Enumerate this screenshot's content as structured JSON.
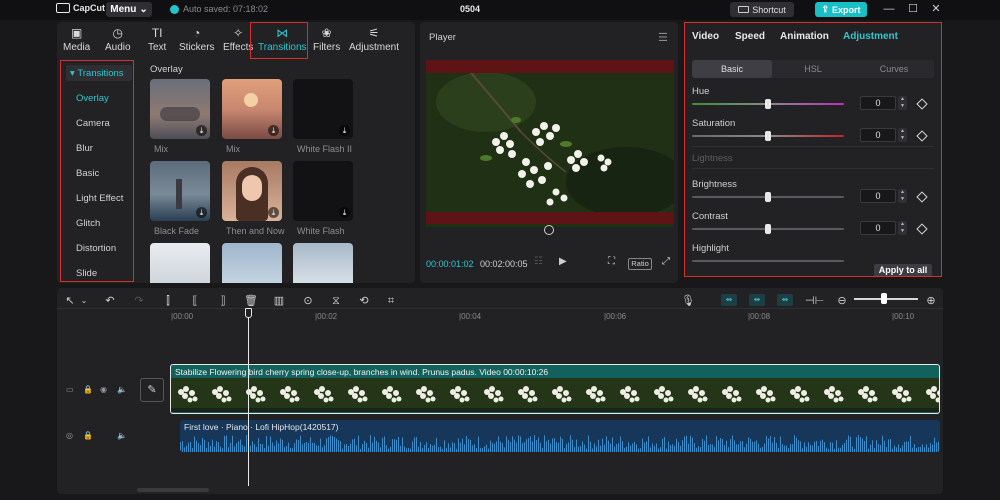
{
  "titlebar": {
    "logo_text": "CapCut",
    "menu_label": "Menu",
    "autosave": "Auto saved: 07:18:02",
    "project_name": "0504",
    "shortcut_label": "Shortcut",
    "export_label": "Export"
  },
  "media": {
    "tabs": [
      {
        "label": "Media",
        "icon": "media-icon",
        "active": false
      },
      {
        "label": "Audio",
        "icon": "audio-icon",
        "active": false
      },
      {
        "label": "Text",
        "icon": "text-icon",
        "active": false
      },
      {
        "label": "Stickers",
        "icon": "stickers-icon",
        "active": false
      },
      {
        "label": "Effects",
        "icon": "effects-icon",
        "active": false
      },
      {
        "label": "Transitions",
        "icon": "transitions-icon",
        "active": true
      },
      {
        "label": "Filters",
        "icon": "filters-icon",
        "active": false
      },
      {
        "label": "Adjustment",
        "icon": "adjustment-icon",
        "active": false
      }
    ],
    "category_header": "Transitions",
    "categories": [
      "Overlay",
      "Camera",
      "Blur",
      "Basic",
      "Light Effect",
      "Glitch",
      "Distortion",
      "Slide"
    ],
    "active_category": "Overlay",
    "section_title": "Overlay",
    "tiles": [
      {
        "label": "Mix"
      },
      {
        "label": "Mix"
      },
      {
        "label": "White Flash II"
      },
      {
        "label": "Black Fade"
      },
      {
        "label": "Then and Now"
      },
      {
        "label": "White Flash"
      }
    ]
  },
  "player": {
    "title": "Player",
    "time_current": "00:00:01:02",
    "time_total": "00:02:00:05",
    "ratio_label": "Ratio"
  },
  "inspector": {
    "tabs": [
      "Video",
      "Speed",
      "Animation",
      "Adjustment"
    ],
    "active_tab": "Adjustment",
    "subtabs": [
      "Basic",
      "HSL",
      "Curves"
    ],
    "active_subtab": "Basic",
    "properties": [
      {
        "label": "Hue",
        "value": "0"
      },
      {
        "label": "Saturation",
        "value": "0"
      },
      {
        "label": "Brightness",
        "value": "0"
      },
      {
        "label": "Contrast",
        "value": "0"
      },
      {
        "label": "Highlight"
      }
    ],
    "section_lightness": "Lightness",
    "apply_all_label": "Apply to all"
  },
  "timeline": {
    "ruler_labels": [
      "|00:00",
      "|00:02",
      "|00:04",
      "|00:06",
      "|00:08",
      "|00:10"
    ],
    "video_clip_header": "Stabilize  Flowering bird cherry spring close-up, branches in wind. Prunus padus. Video  00:00:10:26",
    "audio_clip_header": "First love · Piano · Lofi HipHop(1420517)"
  },
  "colors": {
    "accent": "#2fc7cd",
    "highlight_box": "#d72e2e",
    "video_clip": "#13615d",
    "audio_clip": "#16365a"
  }
}
